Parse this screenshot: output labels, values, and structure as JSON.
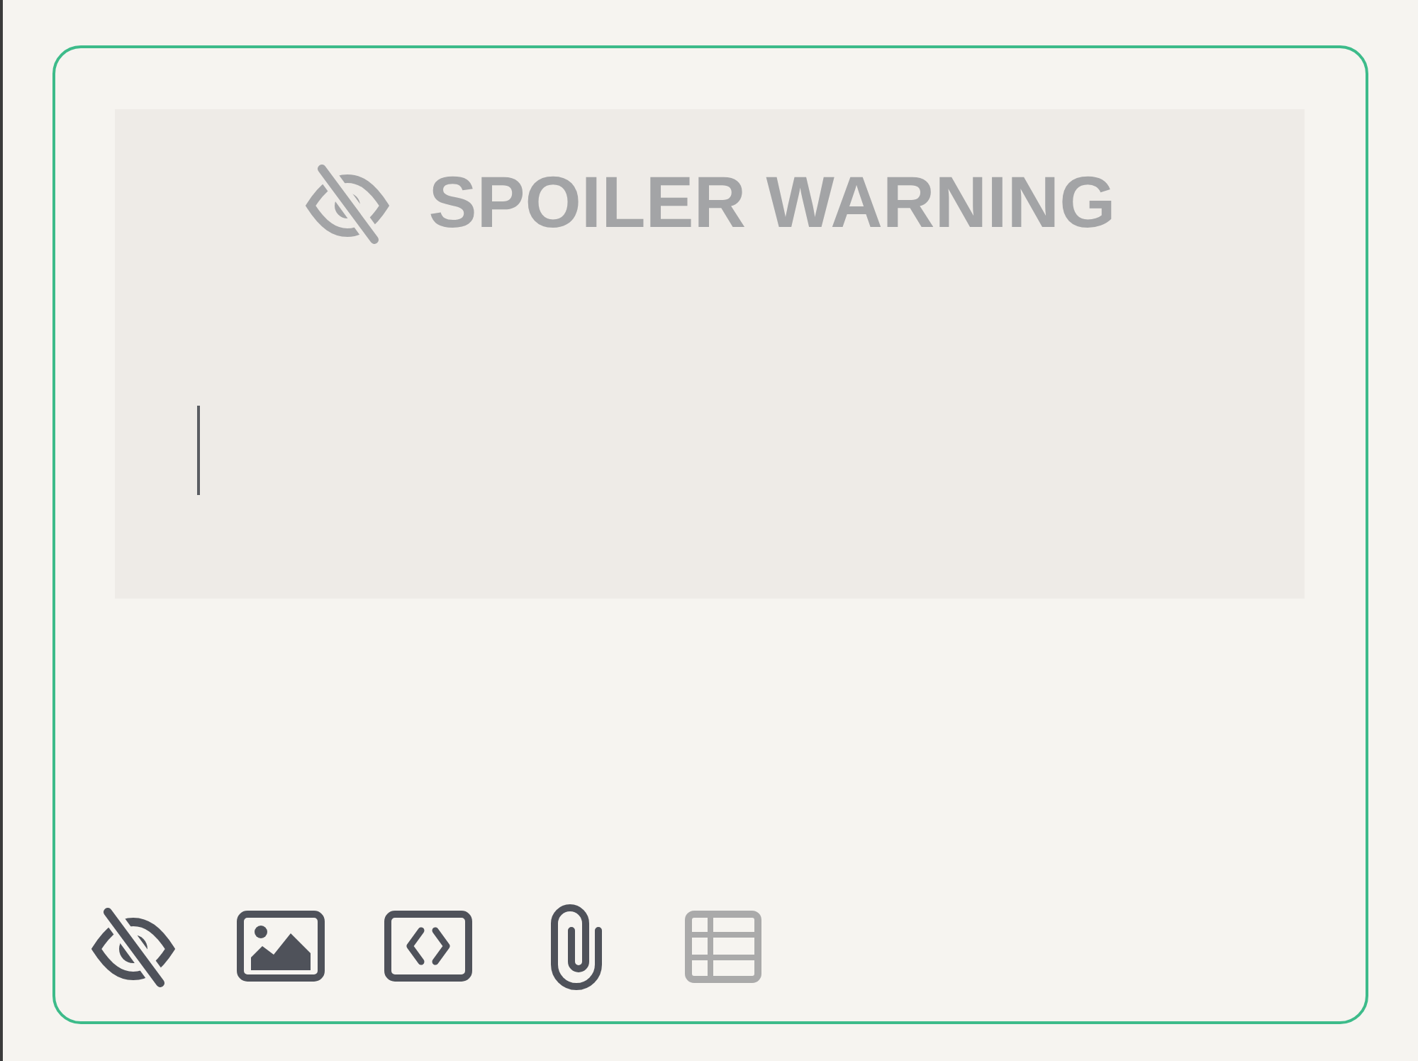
{
  "editor": {
    "focused": true,
    "spoiler": {
      "title": "SPOILER WARNING",
      "focused": true
    },
    "toolbar": [
      {
        "kind": "spoiler",
        "disabled": false
      },
      {
        "kind": "image",
        "disabled": false
      },
      {
        "kind": "code",
        "disabled": false
      },
      {
        "kind": "attachment",
        "disabled": false
      },
      {
        "kind": "table",
        "disabled": true
      }
    ]
  }
}
